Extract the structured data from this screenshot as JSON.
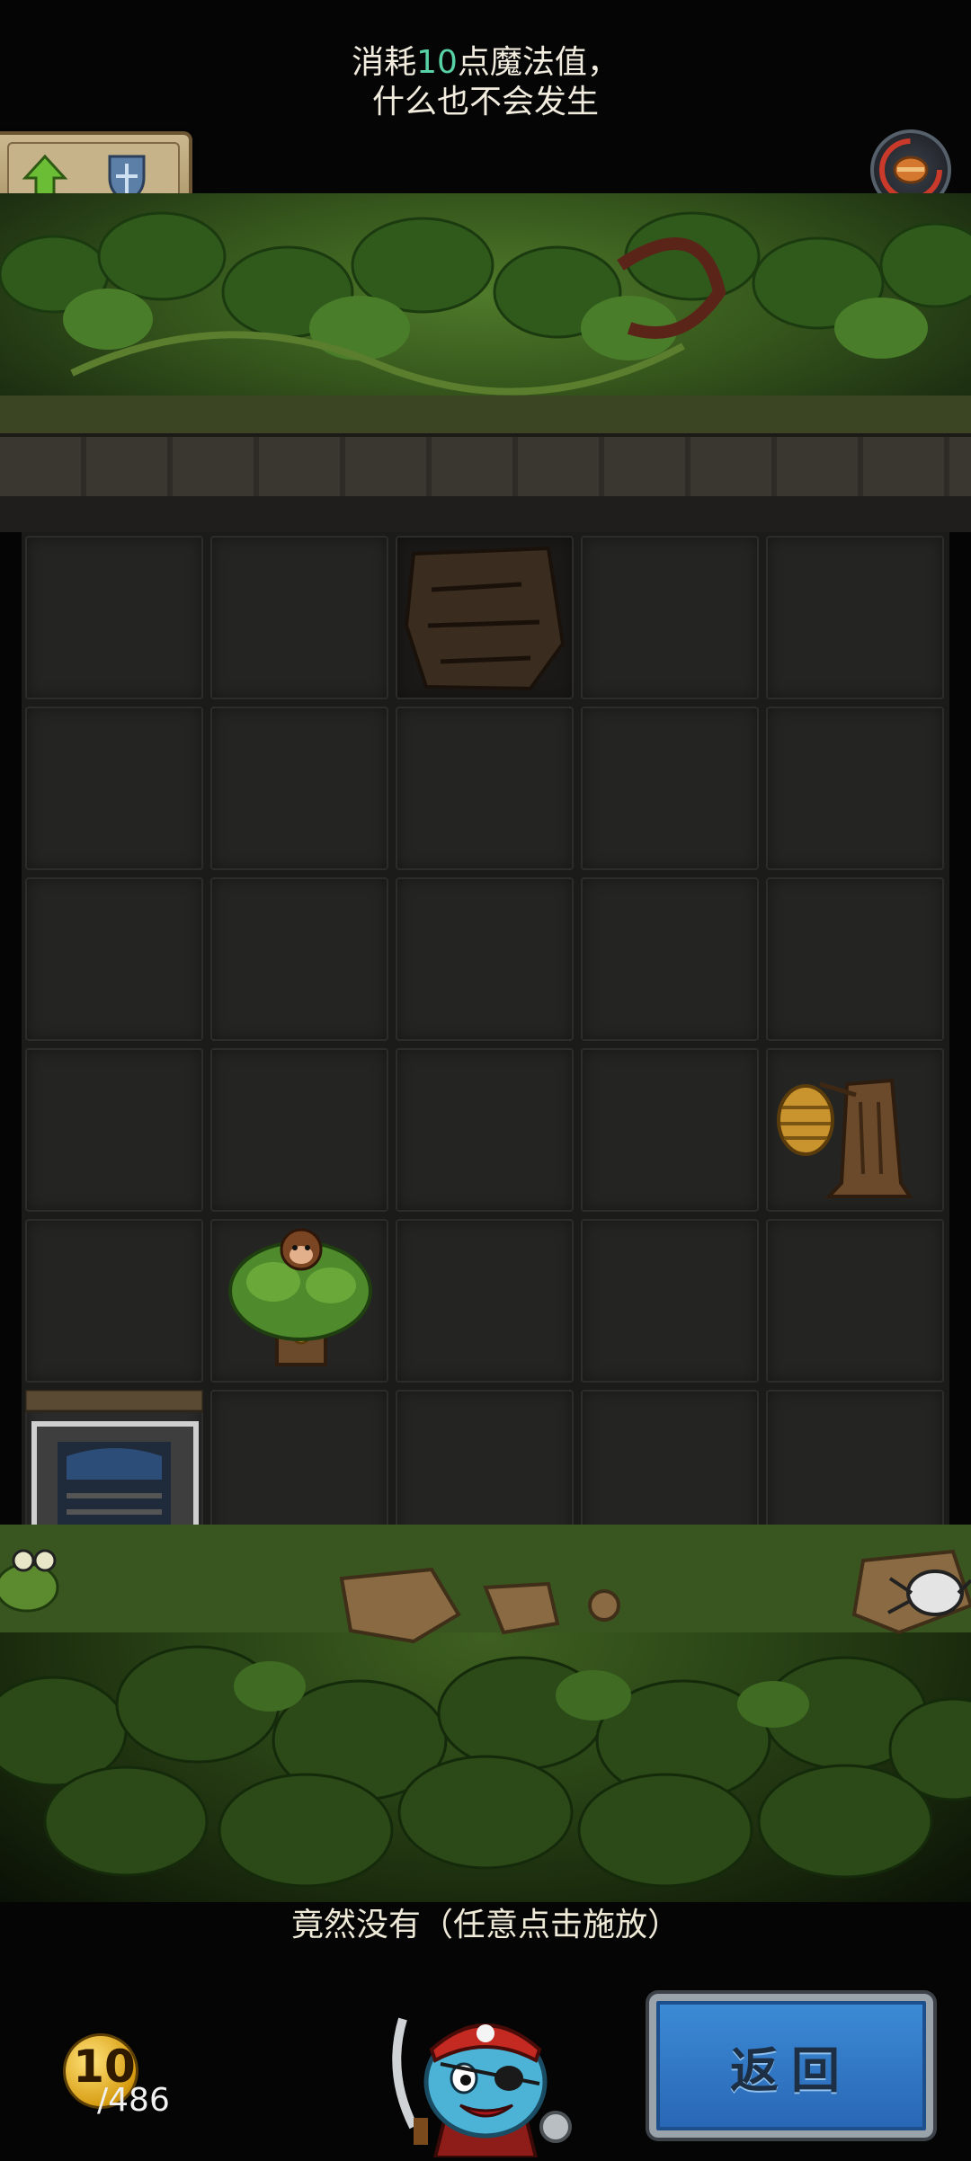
{
  "message": {
    "line1_prefix": "消耗",
    "line1_value": "10",
    "line1_suffix": "点魔法值，",
    "line2": "什么也不会发生"
  },
  "hint": "竟然没有（任意点击施放）",
  "mana": {
    "current": "10",
    "max": "/486"
  },
  "return_label": "返回",
  "icons": {
    "buff_up": "green-up-arrow-icon",
    "shield": "shield-icon",
    "stomach": "stomach-gauge-icon"
  },
  "colors": {
    "highlight": "#58d1a4",
    "button_blue": "#2f78c8"
  }
}
